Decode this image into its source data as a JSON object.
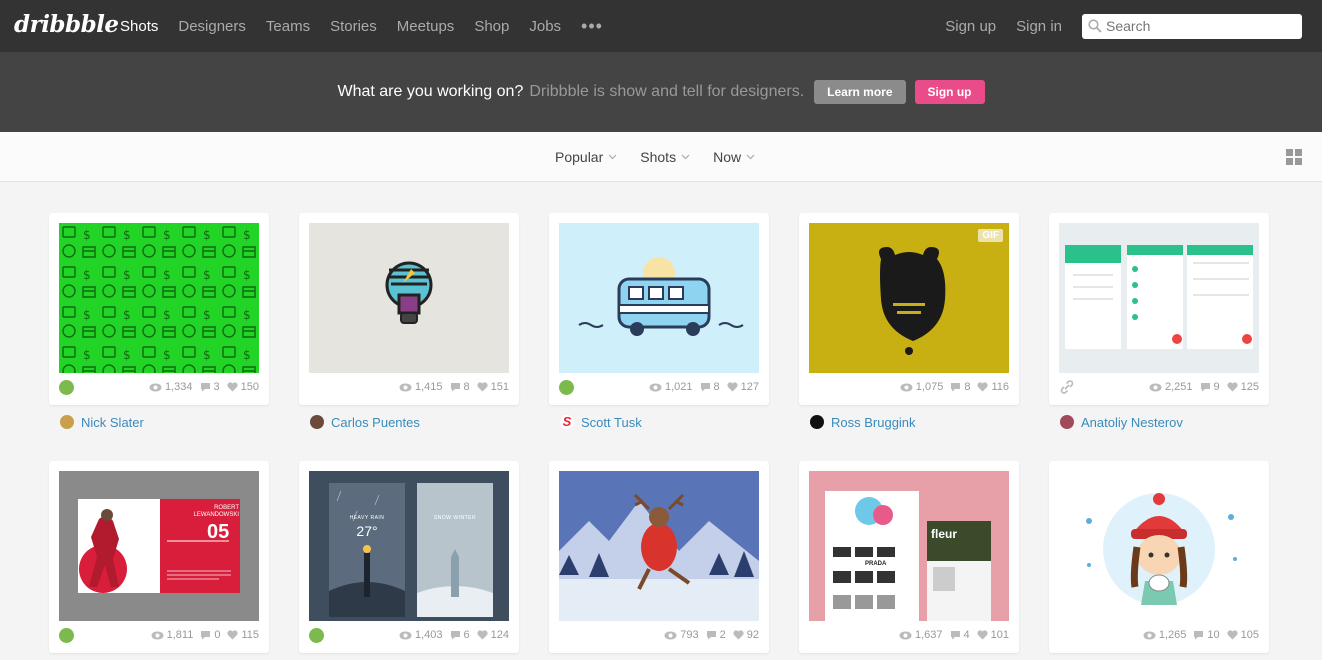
{
  "nav": {
    "logo": "dribbble",
    "links": [
      "Shots",
      "Designers",
      "Teams",
      "Stories",
      "Meetups",
      "Shop",
      "Jobs"
    ],
    "more": "•••",
    "signup": "Sign up",
    "signin": "Sign in",
    "search_placeholder": "Search"
  },
  "banner": {
    "question": "What are you working on?",
    "subtitle": "Dribbble is show and tell for designers.",
    "learn_more": "Learn more",
    "sign_up": "Sign up"
  },
  "filters": {
    "sort": "Popular",
    "type": "Shots",
    "time": "Now"
  },
  "shots": [
    {
      "views": "1,334",
      "comments": "3",
      "likes": "150",
      "author": "Nick Slater",
      "badge": "rebound",
      "thumb_color": "#22d425"
    },
    {
      "views": "1,415",
      "comments": "8",
      "likes": "151",
      "author": "Carlos Puentes",
      "badge": "",
      "thumb_color": "#e6e4de"
    },
    {
      "views": "1,021",
      "comments": "8",
      "likes": "127",
      "author": "Scott Tusk",
      "badge": "rebound",
      "thumb_color": "#cfeffa"
    },
    {
      "views": "1,075",
      "comments": "8",
      "likes": "116",
      "author": "Ross Bruggink",
      "badge": "",
      "gif": "GIF",
      "thumb_color": "#c8b012"
    },
    {
      "views": "2,251",
      "comments": "9",
      "likes": "125",
      "author": "Anatoliy Nesterov",
      "badge": "link",
      "thumb_color": "#e8edf0"
    },
    {
      "views": "1,811",
      "comments": "0",
      "likes": "115",
      "badge": "rebound",
      "thumb_color": "#8a8a8a",
      "thumb_text": {
        "name": "ROBERT LEWANDOWSKI",
        "number": "05"
      }
    },
    {
      "views": "1,403",
      "comments": "6",
      "likes": "124",
      "badge": "rebound",
      "thumb_color": "#3e4e5e",
      "thumb_text": {
        "left": "HEAVY RAIN",
        "right": "SNOW WINTER",
        "temp": "27°"
      }
    },
    {
      "views": "793",
      "comments": "2",
      "likes": "92",
      "badge": "",
      "thumb_color": "#4a64a8"
    },
    {
      "views": "1,637",
      "comments": "4",
      "likes": "101",
      "badge": "",
      "thumb_color": "#e8a0a8",
      "thumb_text": {
        "brand": "fleur",
        "label": "PRADA"
      }
    },
    {
      "views": "1,265",
      "comments": "10",
      "likes": "105",
      "badge": "",
      "thumb_color": "#ffffff"
    }
  ],
  "colors": {
    "topnav": "#333333",
    "banner": "#444444",
    "pink": "#ea4c89",
    "link": "#3a8bbb",
    "rebound": "#7dba4d"
  }
}
